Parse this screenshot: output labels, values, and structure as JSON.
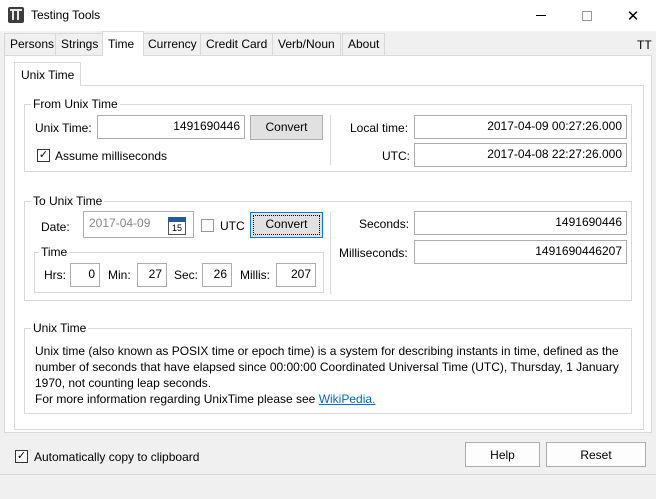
{
  "window": {
    "title": "Testing Tools",
    "icons": {
      "app": "app-icon",
      "minimize": "minimize-icon",
      "maximize": "maximize-icon",
      "close": "close-icon"
    },
    "close_glyph": "✕"
  },
  "tabs": [
    "Persons",
    "Strings",
    "Time",
    "Currency",
    "Credit Card",
    "Verb/Noun",
    "About"
  ],
  "active_tab": "Time",
  "corner_label": "TT",
  "subtab": {
    "label": "Unix Time"
  },
  "from_unix": {
    "title": "From Unix Time",
    "unix_time_label": "Unix Time:",
    "unix_time_value": "1491690446",
    "convert_label": "Convert",
    "assume_ms_label": "Assume milliseconds",
    "assume_ms_checked": true,
    "check_glyph": "✓",
    "local_time_label": "Local time:",
    "local_time_value": "2017-04-09 00:27:26.000",
    "utc_label": "UTC:",
    "utc_value": "2017-04-08 22:27:26.000"
  },
  "to_unix": {
    "title": "To Unix Time",
    "date_label": "Date:",
    "date_value": "2017-04-09",
    "calendar_day": "15",
    "utc_checkbox_label": "UTC",
    "utc_checked": false,
    "convert_label": "Convert",
    "time_group_title": "Time",
    "hrs_label": "Hrs:",
    "hrs_value": "0",
    "min_label": "Min:",
    "min_value": "27",
    "sec_label": "Sec:",
    "sec_value": "26",
    "millis_label": "Millis:",
    "millis_value": "207",
    "seconds_label": "Seconds:",
    "seconds_value": "1491690446",
    "milliseconds_label": "Milliseconds:",
    "milliseconds_value": "1491690446207"
  },
  "unix_info": {
    "title": "Unix Time",
    "line1": "Unix time (also known as POSIX time or epoch time) is a system for describing instants in time, defined as the",
    "line2": "number of seconds that have elapsed since 00:00:00 Coordinated Universal Time (UTC), Thursday, 1 January",
    "line3": "1970, not counting leap seconds.",
    "more_info_prefix": "For more information regarding UnixTime please see ",
    "link_text": "WikiPedia."
  },
  "footer": {
    "auto_copy_label": "Automatically copy to clipboard",
    "auto_copy_checked": true,
    "help_label": "Help",
    "reset_label": "Reset"
  }
}
